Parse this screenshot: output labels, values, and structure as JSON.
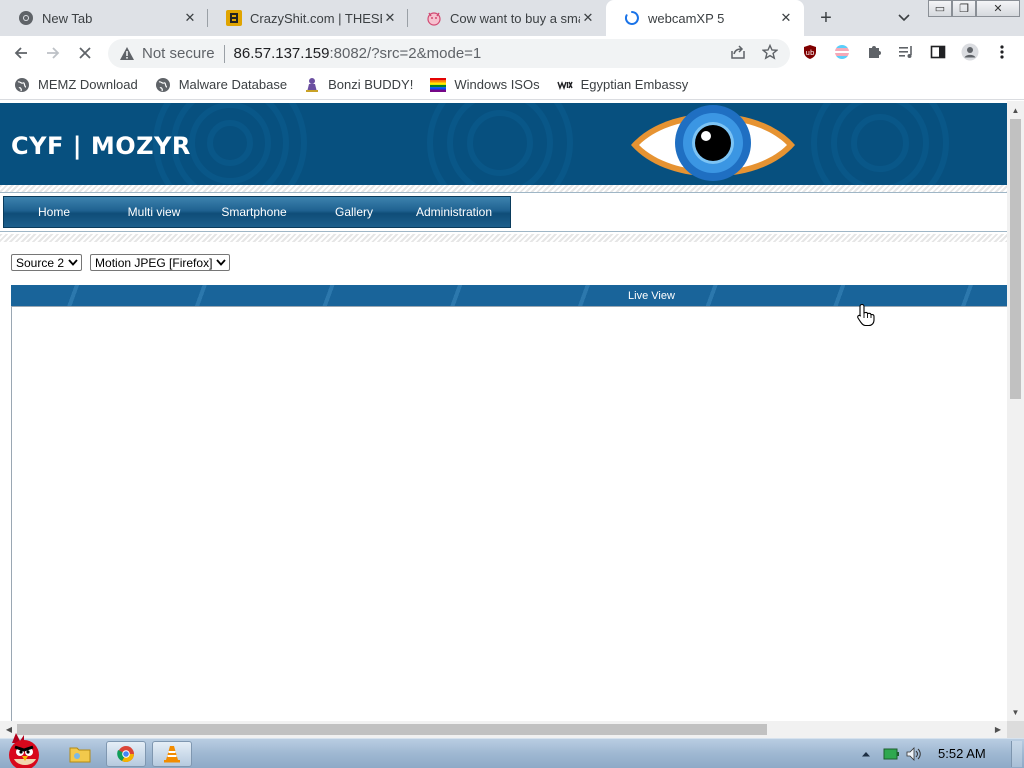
{
  "window": {
    "controls": {
      "minimize": "▭",
      "restore": "❐",
      "close": "✕"
    }
  },
  "tabs": [
    {
      "title": "New Tab",
      "favicon": "chrome-icon",
      "active": false
    },
    {
      "title": "CrazyShit.com | THESE",
      "favicon": "crazyshit-icon",
      "active": false
    },
    {
      "title": "Cow want to buy a sma",
      "favicon": "cow-icon",
      "active": false
    },
    {
      "title": "webcamXP 5",
      "favicon": "loading-spinner-icon",
      "active": true
    }
  ],
  "tab_close_glyph": "✕",
  "new_tab_glyph": "+",
  "toolbar": {
    "security_label": "Not secure",
    "url_host": "86.57.137.159",
    "url_rest": ":8082/?src=2&mode=1"
  },
  "bookmarks": [
    {
      "label": "MEMZ Download",
      "icon": "globe-icon"
    },
    {
      "label": "Malware Database",
      "icon": "globe-icon"
    },
    {
      "label": "Bonzi BUDDY!",
      "icon": "bonzi-icon"
    },
    {
      "label": "Windows ISOs",
      "icon": "pride-flag-icon"
    },
    {
      "label": "Egyptian Embassy",
      "icon": "wix-icon"
    }
  ],
  "site": {
    "title": "CYF | MOZYR",
    "menu": [
      "Home",
      "Multi view",
      "Smartphone",
      "Gallery",
      "Administration"
    ],
    "source_select": "Source 2",
    "format_select": "Motion JPEG [Firefox]",
    "panel_title": "Live View"
  },
  "taskbar": {
    "time": "5:52 AM"
  },
  "colors": {
    "banner": "#07507f",
    "menu": "#1f6291",
    "tabstrip": "#dee1e6",
    "taskbar": "#9fb8d2"
  }
}
